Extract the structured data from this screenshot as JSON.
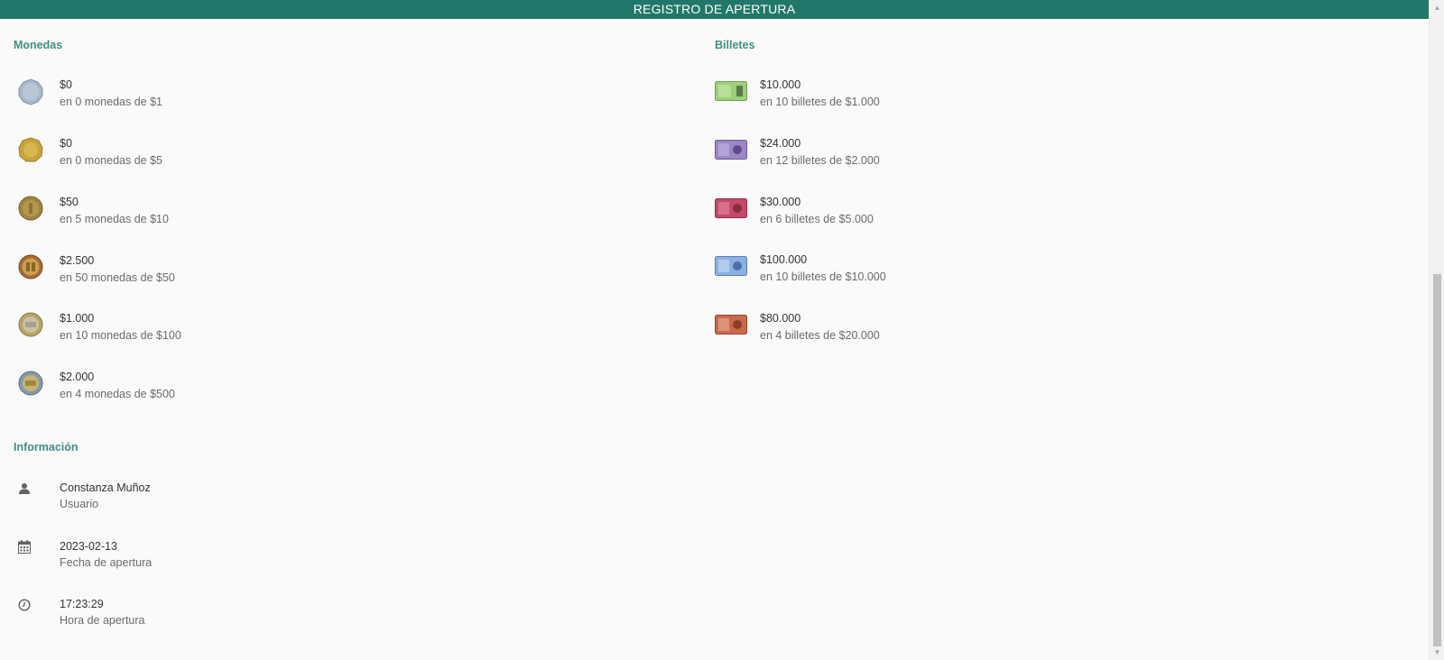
{
  "header": {
    "title": "REGISTRO DE APERTURA"
  },
  "monedas": {
    "title": "Monedas",
    "items": [
      {
        "icon": "coin-1-icon",
        "amount": "$0",
        "detail": "en 0 monedas de $1"
      },
      {
        "icon": "coin-5-icon",
        "amount": "$0",
        "detail": "en 0 monedas de $5"
      },
      {
        "icon": "coin-10-icon",
        "amount": "$50",
        "detail": "en 5 monedas de $10"
      },
      {
        "icon": "coin-50-icon",
        "amount": "$2.500",
        "detail": "en 50 monedas de $50"
      },
      {
        "icon": "coin-100-icon",
        "amount": "$1.000",
        "detail": "en 10 monedas de $100"
      },
      {
        "icon": "coin-500-icon",
        "amount": "$2.000",
        "detail": "en 4 monedas de $500"
      }
    ]
  },
  "billetes": {
    "title": "Billetes",
    "items": [
      {
        "icon": "bill-1000-icon",
        "amount": "$10.000",
        "detail": "en 10 billetes de $1.000"
      },
      {
        "icon": "bill-2000-icon",
        "amount": "$24.000",
        "detail": "en 12 billetes de $2.000"
      },
      {
        "icon": "bill-5000-icon",
        "amount": "$30.000",
        "detail": "en 6 billetes de $5.000"
      },
      {
        "icon": "bill-10000-icon",
        "amount": "$100.000",
        "detail": "en 10 billetes de $10.000"
      },
      {
        "icon": "bill-20000-icon",
        "amount": "$80.000",
        "detail": "en 4 billetes de $20.000"
      }
    ]
  },
  "informacion": {
    "title": "Información",
    "items": [
      {
        "icon": "user-icon",
        "value": "Constanza Muñoz",
        "label": "Usuario"
      },
      {
        "icon": "calendar-icon",
        "value": "2023-02-13",
        "label": "Fecha de apertura"
      },
      {
        "icon": "clock-icon",
        "value": "17:23:29",
        "label": "Hora de apertura"
      }
    ]
  },
  "colors": {
    "header": "#21786a",
    "section_title": "#3f8f81",
    "coin_aluminium": "#a8b8c8",
    "coin_gold": "#c9a43a",
    "coin_bronze": "#a08440",
    "coin_copper": "#a86a30",
    "coin_bimetal_100": "#b8a466",
    "coin_bimetal_500": "#8898ac",
    "bill_1000": "#9ccf7a",
    "bill_2000": "#9c86c6",
    "bill_5000": "#c44a6a",
    "bill_10000": "#8cb0e0",
    "bill_20000": "#c86a4a"
  }
}
